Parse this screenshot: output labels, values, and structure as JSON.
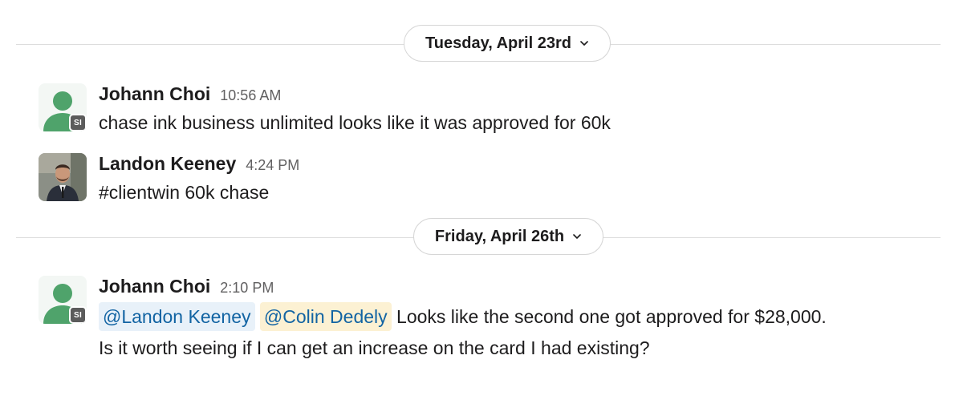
{
  "dividers": [
    {
      "label": "Tuesday, April 23rd",
      "icon": "chevron-down-icon"
    },
    {
      "label": "Friday, April 26th",
      "icon": "chevron-down-icon"
    }
  ],
  "messages": [
    {
      "sender": "Johann Choi",
      "time": "10:56 AM",
      "avatar": "generic-user-avatar",
      "badge": "SI",
      "text": "chase ink business unlimited looks like it was approved for 60k"
    },
    {
      "sender": "Landon Keeney",
      "time": "4:24 PM",
      "avatar": "photo-avatar",
      "text": "#clientwin 60k chase"
    },
    {
      "sender": "Johann Choi",
      "time": "2:10 PM",
      "avatar": "generic-user-avatar",
      "badge": "SI",
      "mentions": [
        "@Landon Keeney",
        "@Colin Dedely"
      ],
      "text_line1": "Looks like the second one got approved for $28,000.",
      "text_line2": "Is it worth seeing if I can get an increase on the card I had existing?"
    }
  ],
  "colors": {
    "avatar_green": "#4fa36b",
    "mention_blue_bg": "#e8f1f9",
    "mention_yellow_bg": "#fcf1d3",
    "mention_text": "#1264a3",
    "badge_bg": "#5c5c5c"
  }
}
